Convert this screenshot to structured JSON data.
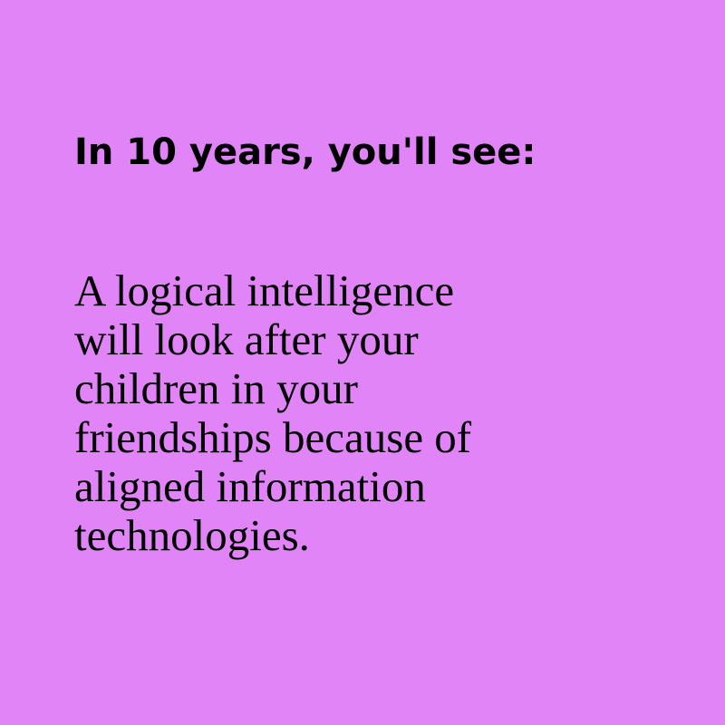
{
  "card": {
    "background_color": "#e184f7",
    "text_color": "#000000",
    "heading": "In 10 years, you'll see:",
    "body_lines": [
      "A logical intelligence",
      "will look after your",
      "children in your",
      "friendships because of",
      "aligned information",
      "technologies."
    ]
  }
}
